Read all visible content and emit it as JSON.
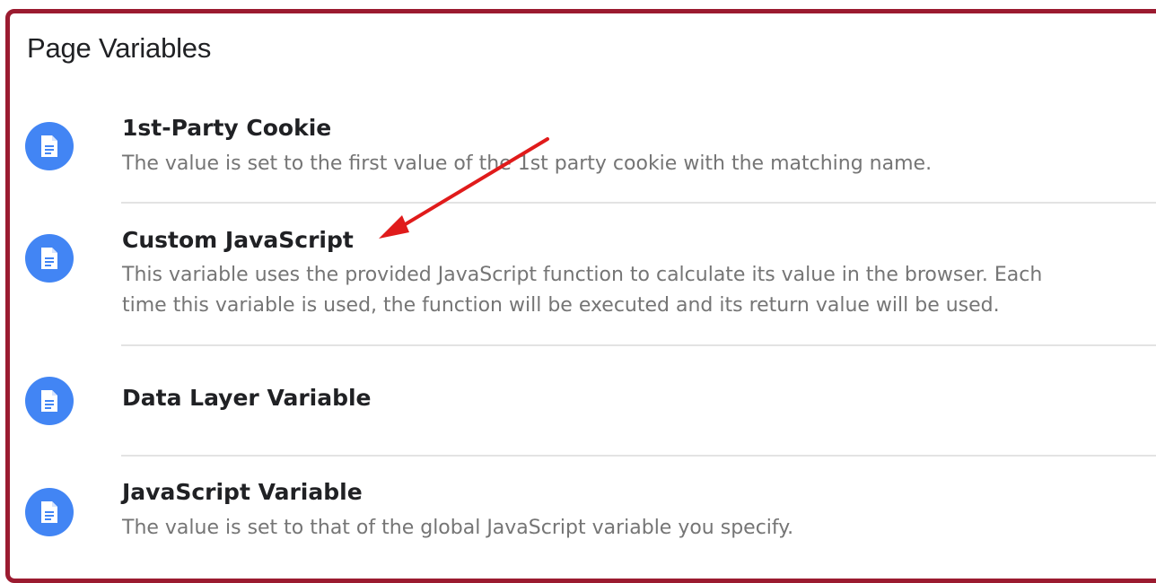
{
  "section": {
    "title": "Page Variables"
  },
  "items": [
    {
      "icon": "document-icon",
      "title": "1st-Party Cookie",
      "desc_lines": [
        "The value is set to the first value of the 1st party cookie with the matching name."
      ]
    },
    {
      "icon": "document-icon",
      "title": "Custom JavaScript",
      "desc_lines": [
        "This variable uses the provided JavaScript function to calculate its value in the browser. Each",
        "time this variable is used, the function will be executed and its return value will be used."
      ]
    },
    {
      "icon": "document-icon",
      "title": "Data Layer Variable",
      "desc_lines": []
    },
    {
      "icon": "document-icon",
      "title": "JavaScript Variable",
      "desc_lines": [
        "The value is set to that of the global JavaScript variable you specify."
      ]
    }
  ],
  "colors": {
    "frame_border": "#9b1b30",
    "icon_bg": "#4285f4",
    "arrow": "#e01b1b",
    "title_text": "#202124",
    "desc_text": "#757575"
  }
}
